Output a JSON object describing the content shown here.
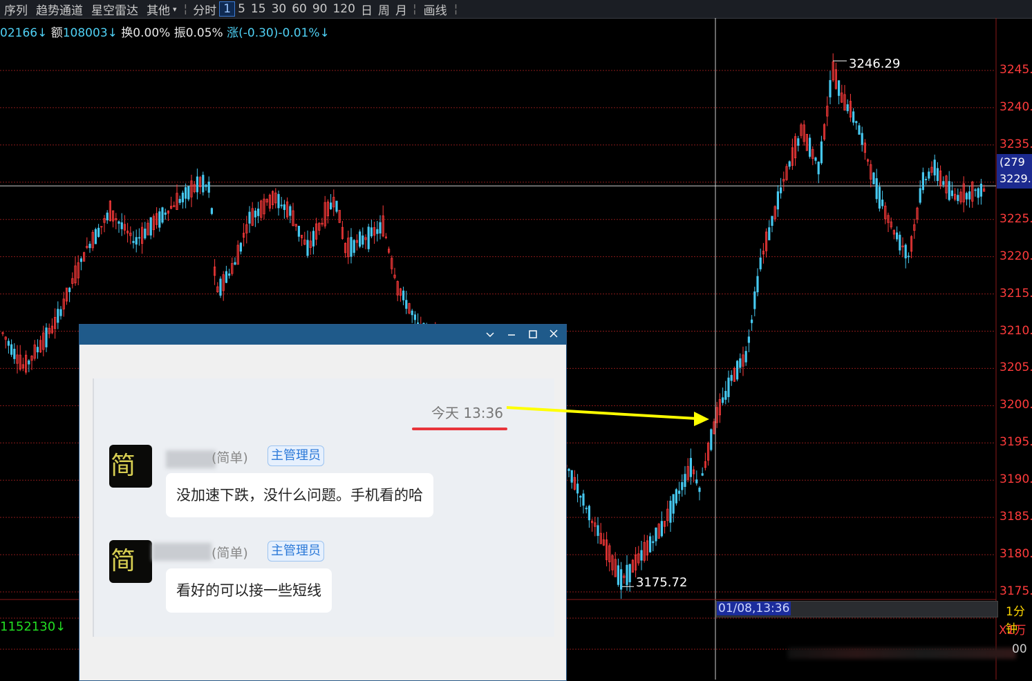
{
  "toolbar": {
    "items": [
      "序列",
      "趋势通道",
      "星空雷达",
      "其他"
    ],
    "other_arrow": "▾",
    "separator": "¦",
    "periods": [
      "分时",
      "1",
      "5",
      "15",
      "30",
      "60",
      "90",
      "120",
      "日",
      "周",
      "月"
    ],
    "active_period": "1",
    "draw_label": "画线"
  },
  "info": {
    "volume": "02166↓",
    "amount_label": "额",
    "amount": "108003↓",
    "turnover_label": "换",
    "turnover": "0.00%",
    "amplitude_label": "振",
    "amplitude": "0.05%",
    "change_label": "涨",
    "change": "(-0.30)-0.01%↓"
  },
  "chart_data": {
    "type": "candlestick",
    "instrument_period": "1分钟",
    "y_axis_ticks": [
      "3245.",
      "3240.",
      "3235.",
      "3229.",
      "3225.",
      "3220.",
      "3215.",
      "3210.",
      "3205.",
      "3200.",
      "3195.",
      "3190.",
      "3185.",
      "3180.",
      "3175."
    ],
    "ylim": [
      3175,
      3248
    ],
    "annotations": {
      "high": "3246.29",
      "low": "3175.72"
    },
    "cursor": {
      "price": "3229.",
      "extra": "(279",
      "date_time": "01/08,13:36"
    },
    "colors": {
      "up": "#ff3b3b",
      "down": "#46c8f0",
      "grid": "#8b1a1a",
      "crosshair": "#d0d0d0"
    },
    "key_points": [
      {
        "x": "start",
        "y": 3210
      },
      {
        "x": "peak1",
        "y": 3230
      },
      {
        "x": "dip1",
        "y": 3214
      },
      {
        "x": "peak2",
        "y": 3228
      },
      {
        "x": "low",
        "y": 3175.72
      },
      {
        "x": "13:36",
        "y": 3199
      },
      {
        "x": "high",
        "y": 3246.29
      },
      {
        "x": "end",
        "y": 3229
      }
    ]
  },
  "bottom": {
    "volume_value": "1152130↓",
    "period": "1分钟",
    "unit": "X1万",
    "right_text": "00"
  },
  "chat": {
    "timestamp": "今天 13:36",
    "messages": [
      {
        "avatar_text": "简单",
        "name_suffix": "(简单)",
        "role": "主管理员",
        "text": "没加速下跌，没什么问题。手机看的哈"
      },
      {
        "avatar_text": "简单",
        "name_suffix": "(简单)",
        "role": "主管理员",
        "text": "看好的可以接一些短线"
      }
    ]
  }
}
